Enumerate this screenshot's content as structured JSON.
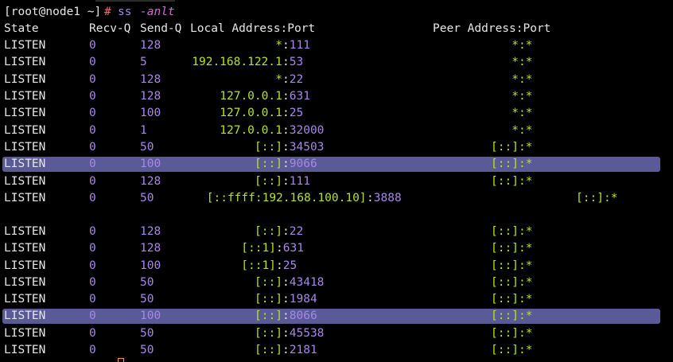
{
  "prompt": {
    "user_host": "[root@node1 ~]",
    "symbol": "#",
    "command": "ss",
    "flags": "-anlt"
  },
  "header": {
    "state": "State",
    "recv_q": "Recv-Q",
    "send_q": "Send-Q",
    "local": "Local Address:Port",
    "peer": "Peer Address:Port"
  },
  "rows": [
    {
      "state": "LISTEN",
      "recv": "0",
      "send": "128",
      "local_host": "*",
      "local_port": "111",
      "peer_host": "*",
      "peer_port": "*"
    },
    {
      "state": "LISTEN",
      "recv": "0",
      "send": "5",
      "local_host": "192.168.122.1",
      "local_port": "53",
      "peer_host": "*",
      "peer_port": "*"
    },
    {
      "state": "LISTEN",
      "recv": "0",
      "send": "128",
      "local_host": "*",
      "local_port": "22",
      "peer_host": "*",
      "peer_port": "*"
    },
    {
      "state": "LISTEN",
      "recv": "0",
      "send": "128",
      "local_host": "127.0.0.1",
      "local_port": "631",
      "peer_host": "*",
      "peer_port": "*"
    },
    {
      "state": "LISTEN",
      "recv": "0",
      "send": "100",
      "local_host": "127.0.0.1",
      "local_port": "25",
      "peer_host": "*",
      "peer_port": "*"
    },
    {
      "state": "LISTEN",
      "recv": "0",
      "send": "1",
      "local_host": "127.0.0.1",
      "local_port": "32000",
      "peer_host": "*",
      "peer_port": "*"
    },
    {
      "state": "LISTEN",
      "recv": "0",
      "send": "50",
      "local_host": "[::]",
      "local_port": "34503",
      "peer_host": "[::]",
      "peer_port": "*"
    },
    {
      "state": "LISTEN",
      "recv": "0",
      "send": "100",
      "local_host": "[::]",
      "local_port": "9066",
      "peer_host": "[::]",
      "peer_port": "*",
      "highlighted": true
    },
    {
      "state": "LISTEN",
      "recv": "0",
      "send": "128",
      "local_host": "[::]",
      "local_port": "111",
      "peer_host": "[::]",
      "peer_port": "*"
    },
    {
      "state": "LISTEN",
      "recv": "0",
      "send": "50",
      "local_host": "[::ffff:192.168.100.10]",
      "local_port": "3888",
      "peer_host": "[::]",
      "peer_port": "*"
    },
    {
      "state": "LISTEN",
      "recv": "0",
      "send": "128",
      "local_host": "[::]",
      "local_port": "22",
      "peer_host": "[::]",
      "peer_port": "*"
    },
    {
      "state": "LISTEN",
      "recv": "0",
      "send": "128",
      "local_host": "[::1]",
      "local_port": "631",
      "peer_host": "[::]",
      "peer_port": "*"
    },
    {
      "state": "LISTEN",
      "recv": "0",
      "send": "100",
      "local_host": "[::1]",
      "local_port": "25",
      "peer_host": "[::]",
      "peer_port": "*"
    },
    {
      "state": "LISTEN",
      "recv": "0",
      "send": "50",
      "local_host": "[::]",
      "local_port": "43418",
      "peer_host": "[::]",
      "peer_port": "*"
    },
    {
      "state": "LISTEN",
      "recv": "0",
      "send": "50",
      "local_host": "[::]",
      "local_port": "1984",
      "peer_host": "[::]",
      "peer_port": "*"
    },
    {
      "state": "LISTEN",
      "recv": "0",
      "send": "100",
      "local_host": "[::]",
      "local_port": "8066",
      "peer_host": "[::]",
      "peer_port": "*",
      "highlighted": true
    },
    {
      "state": "LISTEN",
      "recv": "0",
      "send": "50",
      "local_host": "[::]",
      "local_port": "45538",
      "peer_host": "[::]",
      "peer_port": "*"
    },
    {
      "state": "LISTEN",
      "recv": "0",
      "send": "50",
      "local_host": "[::]",
      "local_port": "2181",
      "peer_host": "[::]",
      "peer_port": "*"
    }
  ],
  "colors": {
    "background": "#000000",
    "text": "#e6e6e6",
    "number": "#a887e6",
    "address": "#b5e61d",
    "prompt_symbol": "#ff6b6b",
    "highlight": "#5a5a96"
  }
}
